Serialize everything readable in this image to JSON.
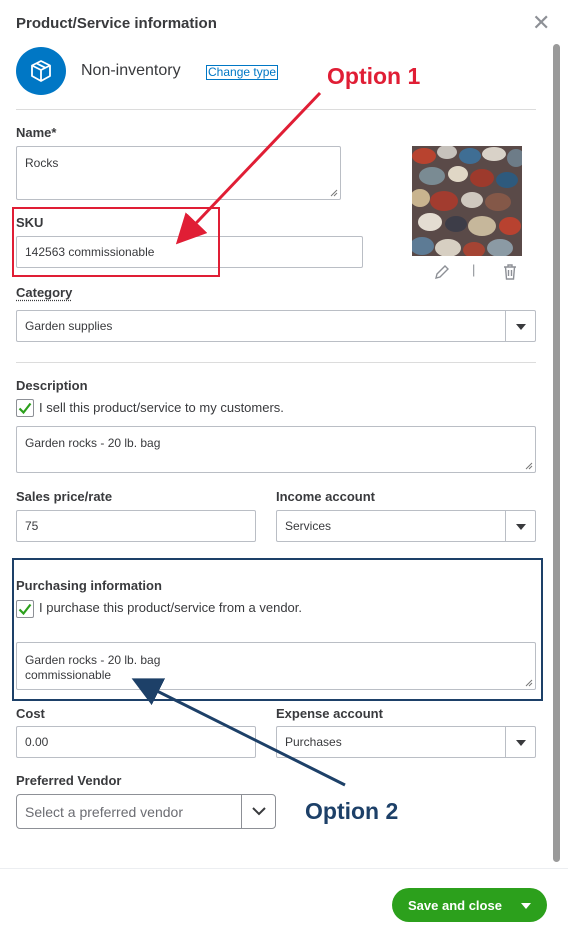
{
  "header": {
    "title": "Product/Service information",
    "close_icon": "close-icon"
  },
  "item_type": {
    "icon": "package-icon",
    "label": "Non-inventory",
    "change_link": "Change type"
  },
  "name": {
    "label": "Name*",
    "value": "Rocks"
  },
  "sku": {
    "label": "SKU",
    "value": "142563 commissionable"
  },
  "category": {
    "label": "Category",
    "value": "Garden supplies"
  },
  "image_actions": {
    "edit_icon": "pencil-icon",
    "separator": "|",
    "delete_icon": "trash-icon"
  },
  "description": {
    "label": "Description",
    "checkbox_label": "I sell this product/service to my customers.",
    "checked": true,
    "value": "Garden rocks - 20 lb. bag"
  },
  "sales": {
    "price_label": "Sales price/rate",
    "price_value": "75",
    "income_label": "Income account",
    "income_value": "Services"
  },
  "purchasing": {
    "label": "Purchasing information",
    "checkbox_label": "I purchase this product/service from a vendor.",
    "checked": true,
    "value_line1": "Garden rocks - 20 lb. bag",
    "value_line2": "commissionable"
  },
  "cost": {
    "label": "Cost",
    "value": "0.00",
    "expense_label": "Expense account",
    "expense_value": "Purchases"
  },
  "vendor": {
    "label": "Preferred Vendor",
    "placeholder": "Select a preferred vendor"
  },
  "footer": {
    "save_label": "Save and close"
  },
  "annotations": {
    "option1": "Option 1",
    "option2": "Option 2"
  },
  "colors": {
    "accent": "#0077c5",
    "primary_button": "#2ca01c",
    "annotation_red": "#e01e35",
    "annotation_navy": "#1d4068"
  }
}
